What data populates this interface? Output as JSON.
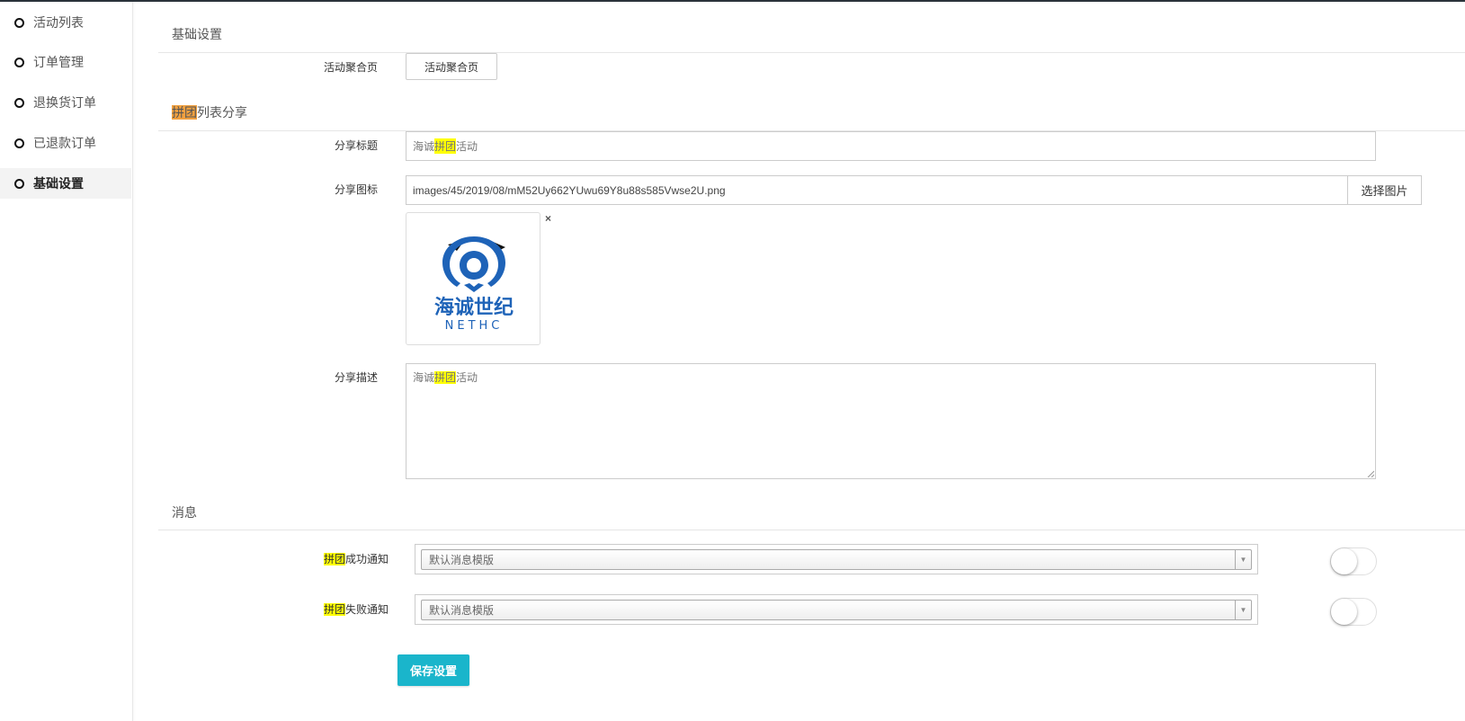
{
  "sidebar": {
    "items": [
      {
        "label": "活动列表"
      },
      {
        "label": "订单管理"
      },
      {
        "label": "退换货订单"
      },
      {
        "label": "已退款订单"
      },
      {
        "label": "基础设置"
      }
    ],
    "active_index": 4
  },
  "basic": {
    "section_title": "基础设置",
    "aggregate_label": "活动聚合页",
    "aggregate_button": "活动聚合页"
  },
  "share": {
    "section_title_hl": "拼团",
    "section_title_rest": "列表分享",
    "title_label": "分享标题",
    "title_value_pre": "海诚",
    "title_value_hl": "拼团",
    "title_value_post": "活动",
    "icon_label": "分享图标",
    "icon_path": "images/45/2019/08/mM52Uy662YUwu69Y8u88s585Vwse2U.png",
    "choose_image_button": "选择图片",
    "thumb_close": "×",
    "logo_text_cn": "海诚世纪",
    "logo_text_en": "NETHC",
    "desc_label": "分享描述",
    "desc_value_pre": "海诚",
    "desc_value_hl": "拼团",
    "desc_value_post": "活动"
  },
  "message": {
    "section_title": "消息",
    "success_label_hl": "拼团",
    "success_label_rest": "成功通知",
    "success_select": "默认消息模版",
    "fail_label_hl": "拼团",
    "fail_label_rest": "失败通知",
    "fail_select": "默认消息模版"
  },
  "save_button": "保存设置",
  "colors": {
    "accent": "#1ab5cb",
    "highlight": "#ffff00",
    "logo_blue": "#1e63b8"
  }
}
